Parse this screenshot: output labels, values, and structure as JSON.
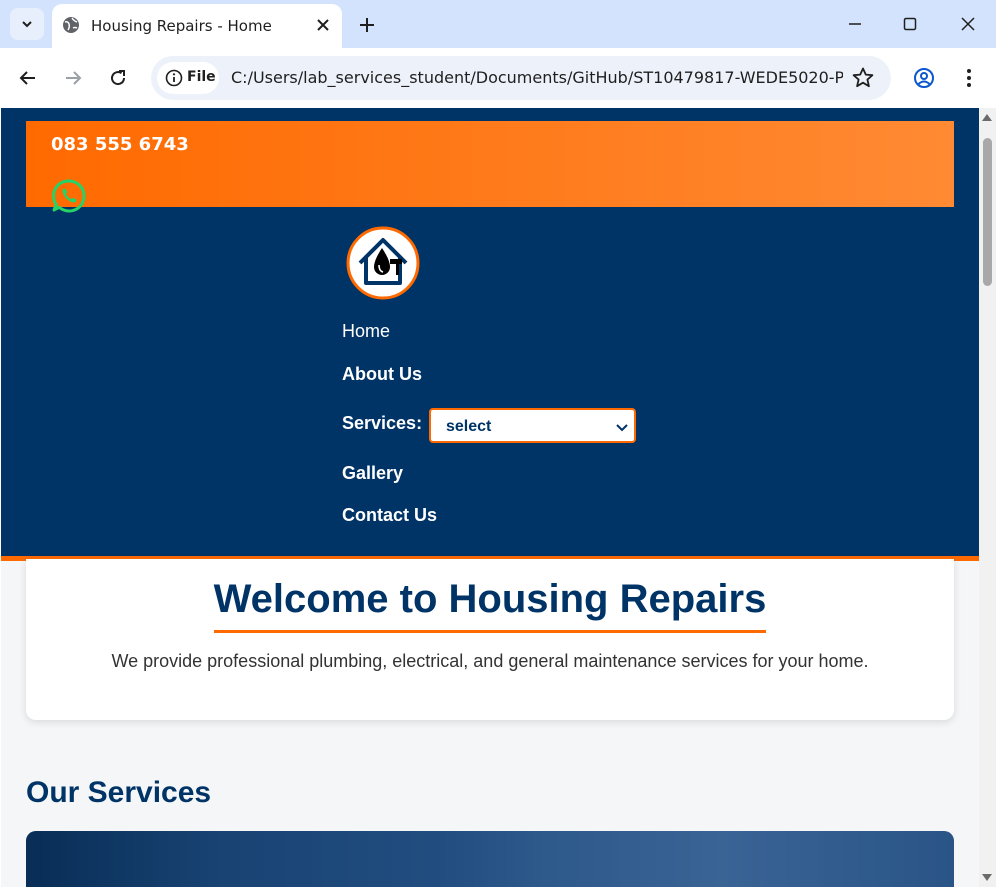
{
  "browser": {
    "tab_title": "Housing Repairs - Home",
    "url_chip": "File",
    "url": "C:/Users/lab_services_student/Documents/GitHub/ST10479817-WEDE5020-P..."
  },
  "page": {
    "phone": "083 555 6743",
    "nav": {
      "home": "Home",
      "about": "About Us",
      "services_label": "Services:",
      "services_select": "select",
      "gallery": "Gallery",
      "contact": "Contact Us"
    },
    "welcome": {
      "heading": "Welcome to Housing Repairs",
      "text": "We provide professional plumbing, electrical, and general maintenance services for your home."
    },
    "services_heading": "Our Services"
  },
  "colors": {
    "navy": "#003366",
    "orange": "#ff6a00",
    "chrome_tabbar": "#d3e3fd",
    "whatsapp_green": "#25d366"
  },
  "icons": [
    "tab-search-icon",
    "globe-icon",
    "close-icon",
    "plus-icon",
    "minimize-icon",
    "maximize-icon",
    "window-close-icon",
    "back-arrow-icon",
    "forward-arrow-icon",
    "reload-icon",
    "info-icon",
    "star-icon",
    "profile-icon",
    "more-vert-icon",
    "whatsapp-icon",
    "logo",
    "chevron-down-icon"
  ]
}
